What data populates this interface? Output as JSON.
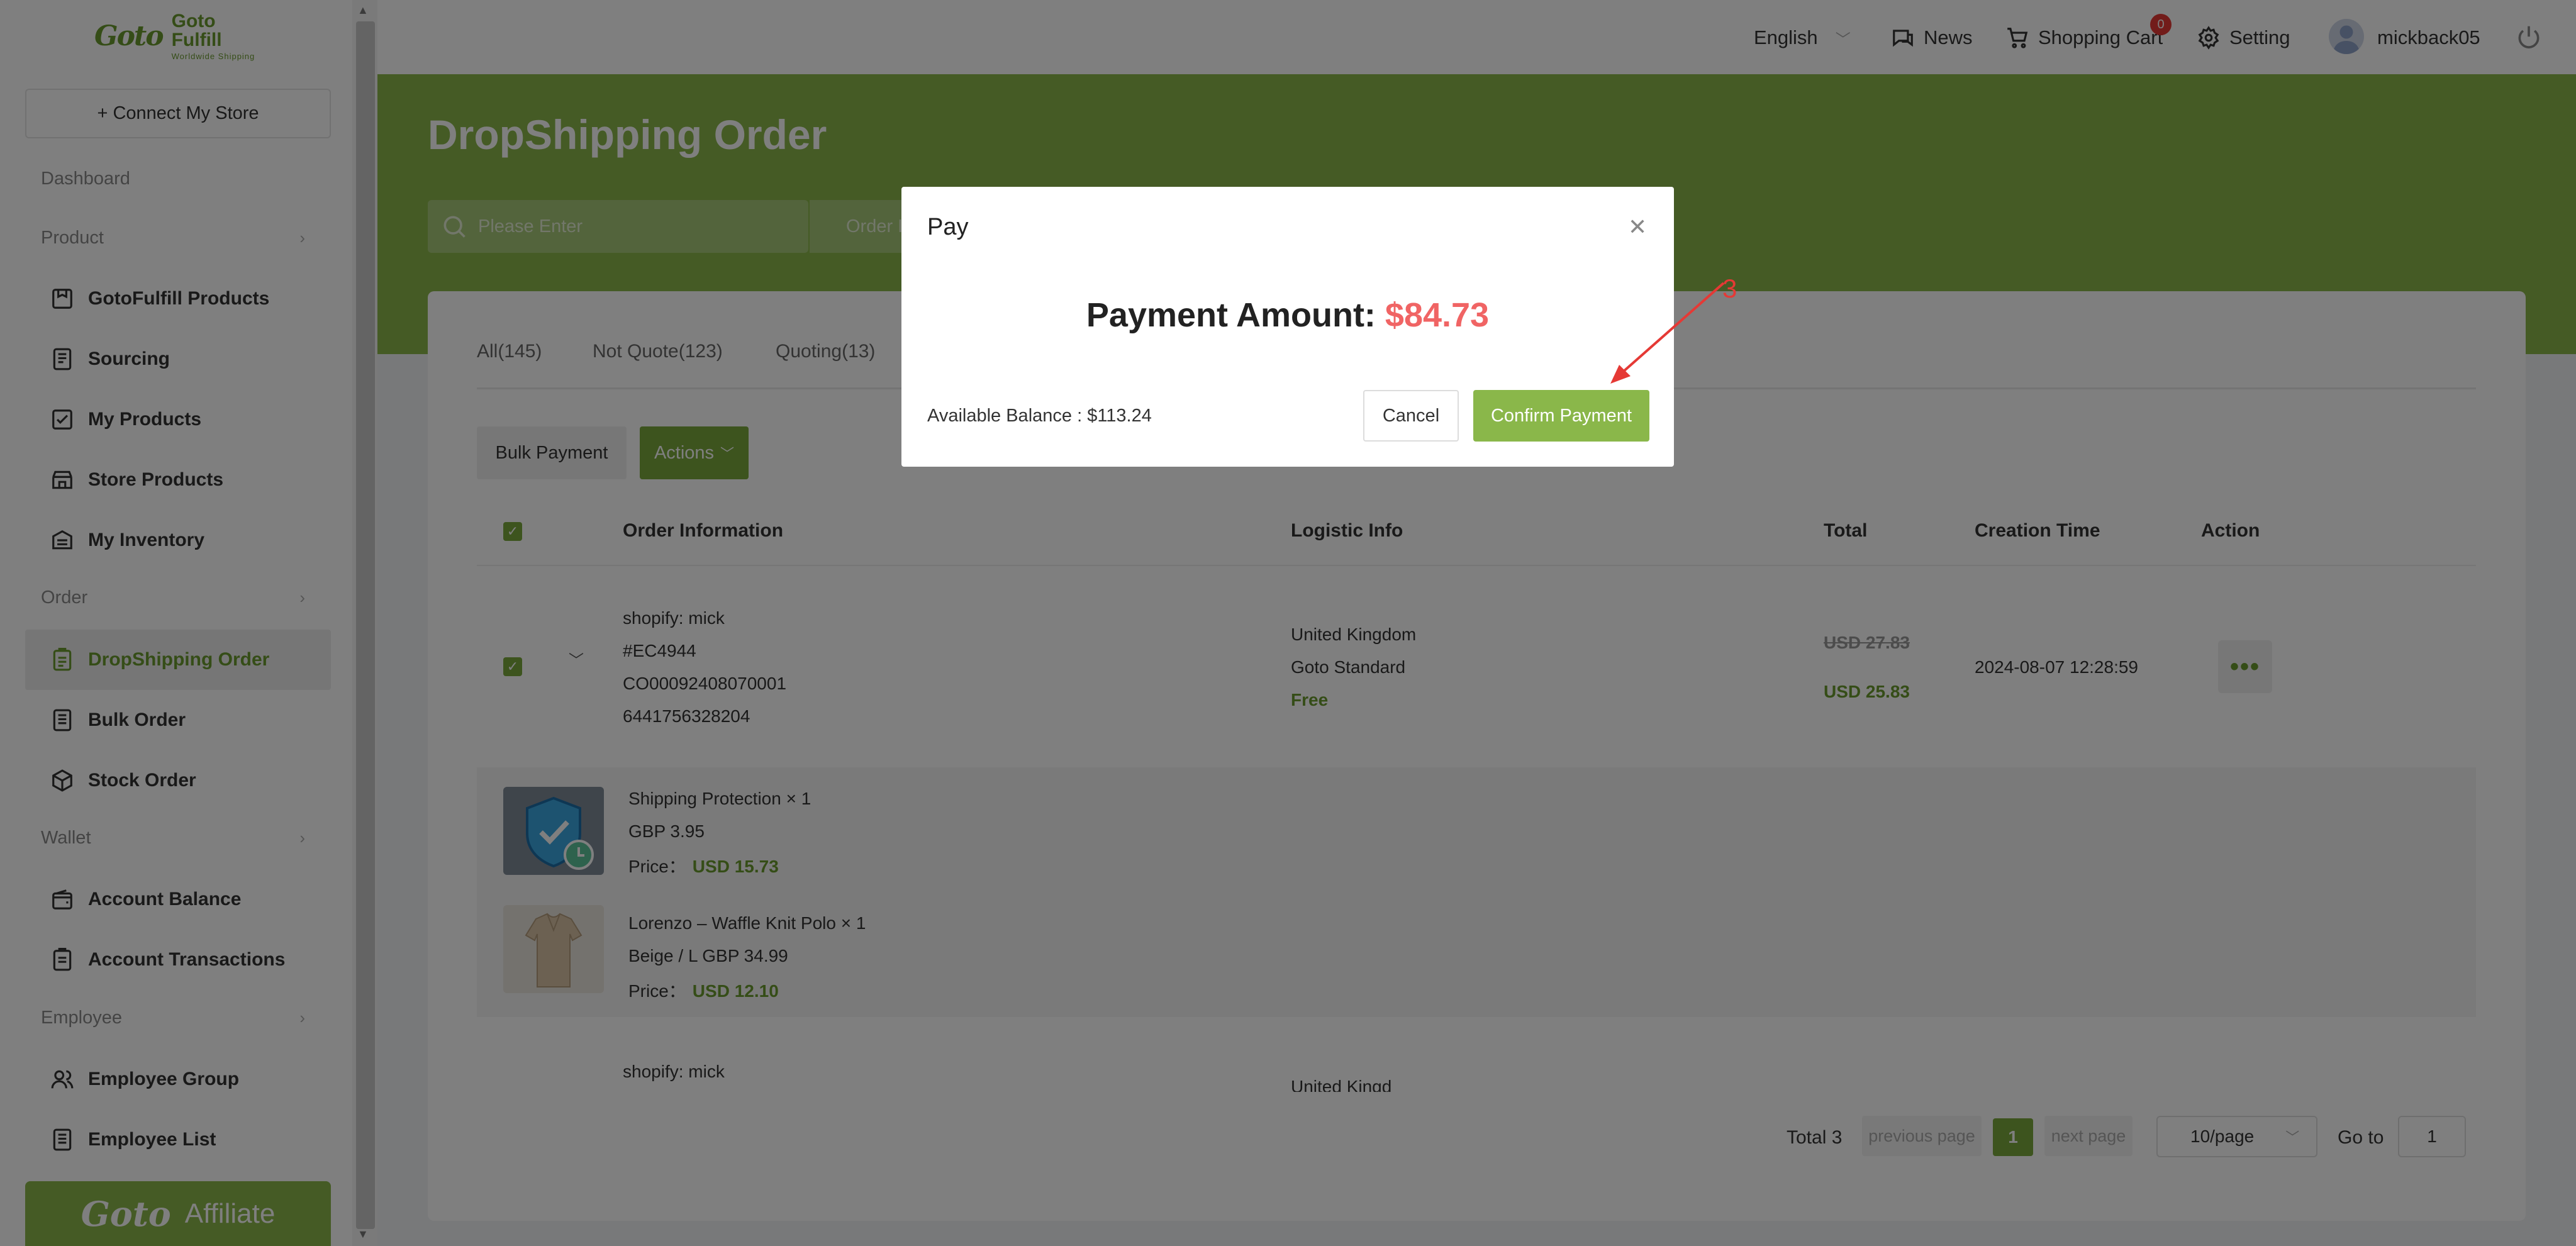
{
  "brand": {
    "logo_glyph": "Goto",
    "name": "Goto Fulfill",
    "tagline": "Worldwide Shipping"
  },
  "sidebar": {
    "connect_label": "+ Connect My Store",
    "sections": {
      "dashboard": "Dashboard",
      "product": "Product",
      "order": "Order",
      "wallet": "Wallet",
      "employee": "Employee"
    },
    "items": [
      {
        "label": "GotoFulfill Products",
        "icon": "product-box-icon"
      },
      {
        "label": "Sourcing",
        "icon": "sourcing-doc-icon"
      },
      {
        "label": "My Products",
        "icon": "checklist-icon"
      },
      {
        "label": "Store Products",
        "icon": "store-icon"
      },
      {
        "label": "My Inventory",
        "icon": "inventory-icon"
      },
      {
        "label": "DropShipping Order",
        "icon": "dropship-order-icon",
        "active": true
      },
      {
        "label": "Bulk Order",
        "icon": "bulk-order-icon"
      },
      {
        "label": "Stock Order",
        "icon": "cube-icon"
      },
      {
        "label": "Account Balance",
        "icon": "wallet-icon"
      },
      {
        "label": "Account Transactions",
        "icon": "transactions-icon"
      },
      {
        "label": "Employee Group",
        "icon": "users-icon"
      },
      {
        "label": "Employee List",
        "icon": "list-icon"
      }
    ],
    "affiliate_label": "Affiliate"
  },
  "header": {
    "language": "English",
    "news": "News",
    "cart": "Shopping Cart",
    "cart_count": "0",
    "setting": "Setting",
    "username": "mickback05"
  },
  "page": {
    "title": "DropShipping Order",
    "search_placeholder": "Please Enter",
    "filter_label": "Order I"
  },
  "tabs": [
    "All(145)",
    "Not Quote(123)",
    "Quoting(13)"
  ],
  "toolbar": {
    "bulk_payment": "Bulk Payment",
    "actions": "Actions"
  },
  "table": {
    "columns": [
      "Order Information",
      "Logistic Info",
      "Total",
      "Creation Time",
      "Action"
    ],
    "order": {
      "store": "shopify: mick",
      "number": "#EC4944",
      "code": "CO00092408070001",
      "id": "6441756328204",
      "country": "United Kingdom",
      "method": "Goto Standard",
      "shipping": "Free",
      "original_total": "USD 27.83",
      "total": "USD 25.83",
      "created": "2024-08-07 12:28:59",
      "more": "•••"
    },
    "products": [
      {
        "name": "Shipping Protection × 1",
        "variant": "GBP 3.95",
        "price_label": "Price：",
        "price": "USD 15.73"
      },
      {
        "name": "Lorenzo – Waffle Knit Polo × 1",
        "variant": "Beige / L GBP 34.99",
        "price_label": "Price：",
        "price": "USD 12.10"
      }
    ],
    "next_order": {
      "store": "shopify: mick",
      "country": "United Kingd"
    }
  },
  "pagination": {
    "total": "Total 3",
    "prev": "previous page",
    "current": "1",
    "next": "next page",
    "page_size": "10/page",
    "goto_label": "Go to",
    "goto_value": "1"
  },
  "modal": {
    "title": "Pay",
    "amount_label": "Payment Amount: ",
    "amount_value": "$84.73",
    "balance": "Available Balance : $113.24",
    "cancel": "Cancel",
    "confirm": "Confirm Payment"
  },
  "annotation": {
    "step": "3",
    "color": "#e53935"
  },
  "colors": {
    "brand_green": "#8ab74a",
    "dark_green": "#6a9a2e",
    "amount_red": "#f06464"
  }
}
